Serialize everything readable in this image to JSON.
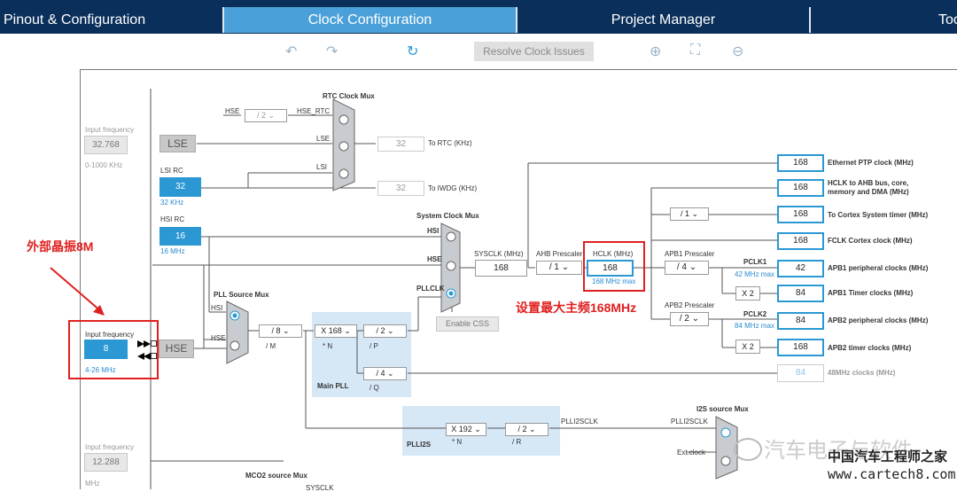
{
  "tabs": [
    "Pinout & Configuration",
    "Clock Configuration",
    "Project Manager",
    "Too"
  ],
  "toolbar": {
    "resolve": "Resolve Clock Issues"
  },
  "rtc_mux": {
    "title": "RTC Clock Mux",
    "hse": "HSE",
    "div": "/ 2",
    "hse_rtc": "HSE_RTC",
    "lse": "LSE",
    "lsi": "LSI",
    "to_rtc": "To RTC (KHz)",
    "rtc_val": "32",
    "to_iwdg": "To IWDG (KHz)",
    "iwdg_val": "32"
  },
  "lse": {
    "label": "Input frequency",
    "value": "32.768",
    "range": "0-1000 KHz",
    "name": "LSE"
  },
  "lsi": {
    "title": "LSI RC",
    "value": "32",
    "unit": "32 KHz"
  },
  "hsi": {
    "title": "HSI RC",
    "value": "16",
    "unit": "16 MHz"
  },
  "hse": {
    "label": "Input frequency",
    "value": "8",
    "range": "4-26 MHz",
    "name": "HSE"
  },
  "pll": {
    "title": "PLL Source Mux",
    "hsi": "HSI",
    "hse": "HSE",
    "m": "/ 8",
    "m_lbl": "/ M",
    "n": "X 168",
    "n_lbl": "* N",
    "p": "/ 2",
    "p_lbl": "/ P",
    "q": "/ 4",
    "q_lbl": "/ Q",
    "main": "Main PLL"
  },
  "sys_mux": {
    "title": "System Clock Mux",
    "hsi": "HSI",
    "hse": "HSE",
    "pllclk": "PLLCLK",
    "css": "Enable CSS"
  },
  "sysclk": {
    "label": "SYSCLK (MHz)",
    "value": "168"
  },
  "ahb": {
    "label": "AHB Prescaler",
    "value": "/ 1"
  },
  "hclk": {
    "label": "HCLK (MHz)",
    "value": "168",
    "max": "168 MHz max"
  },
  "apb1": {
    "label": "APB1 Prescaler",
    "value": "/ 4",
    "pclk": "PCLK1",
    "max": "42 MHz max",
    "x2": "X 2"
  },
  "apb2": {
    "label": "APB2 Prescaler",
    "value": "/ 2",
    "pclk": "PCLK2",
    "max": "84 MHz max",
    "x2": "X 2"
  },
  "cortex_div": "/ 1",
  "outputs": [
    {
      "value": "168",
      "label": "Ethernet PTP clock (MHz)"
    },
    {
      "value": "168",
      "label": "HCLK to AHB bus, core, memory and DMA (MHz)"
    },
    {
      "value": "168",
      "label": "To Cortex System timer (MHz)"
    },
    {
      "value": "168",
      "label": "FCLK Cortex clock (MHz)"
    },
    {
      "value": "42",
      "label": "APB1 peripheral clocks (MHz)"
    },
    {
      "value": "84",
      "label": "APB1 Timer clocks (MHz)"
    },
    {
      "value": "84",
      "label": "APB2 peripheral clocks (MHz)"
    },
    {
      "value": "168",
      "label": "APB2 timer clocks (MHz)"
    },
    {
      "value": "84",
      "label": "48MHz clocks (MHz)"
    }
  ],
  "plli2s": {
    "title": "PLLI2S",
    "n": "X 192",
    "n_lbl": "* N",
    "r": "/ 2",
    "r_lbl": "/ R",
    "clk": "PLLI2SCLK",
    "mux": "I2S source Mux",
    "clk2": "PLLI2SCLK",
    "ext": "Ext.clock"
  },
  "bottom": {
    "label": "Input frequency",
    "value": "12.288",
    "unit": "MHz",
    "mco2": "MCO2 source Mux",
    "sysclk": "SYSCLK"
  },
  "annotations": {
    "crystal": "外部晶振8M",
    "max": "设置最大主频168MHz"
  },
  "watermark": {
    "brand": "汽车电子与软件",
    "site": "中国汽车工程师之家",
    "url": "www.cartech8.com"
  }
}
